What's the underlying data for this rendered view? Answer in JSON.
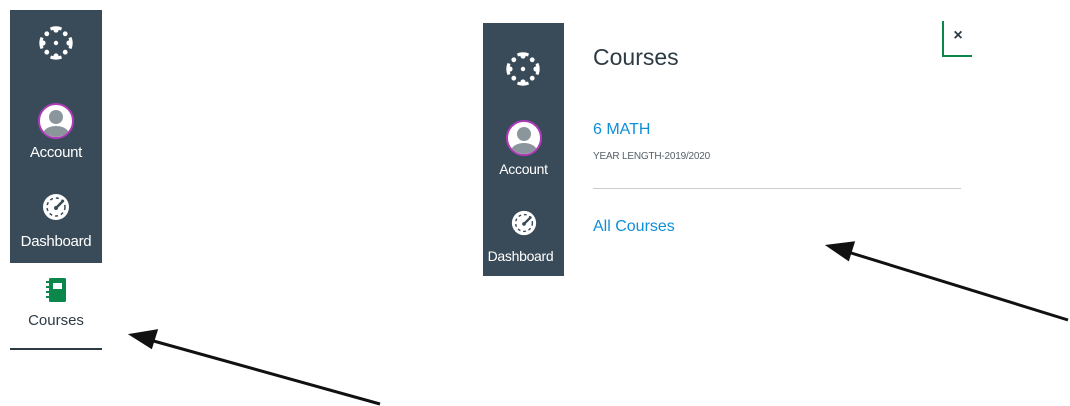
{
  "panel_left": {
    "nav": {
      "account_label": "Account",
      "dashboard_label": "Dashboard",
      "courses_label": "Courses"
    }
  },
  "panel_right": {
    "nav": {
      "account_label": "Account",
      "dashboard_label": "Dashboard"
    },
    "tray": {
      "title": "Courses",
      "close_glyph": "×",
      "course": {
        "name": "6 MATH",
        "term": "YEAR LENGTH-2019/2020"
      },
      "all_courses_label": "All Courses"
    }
  },
  "colors": {
    "nav_bg": "#394b58",
    "link": "#0e8fd8",
    "accent_green": "#0b874b",
    "avatar_ring": "#b03bb8"
  },
  "icons": [
    "canvas-logo-icon",
    "avatar-icon",
    "dashboard-gauge-icon",
    "courses-book-icon",
    "close-icon"
  ]
}
